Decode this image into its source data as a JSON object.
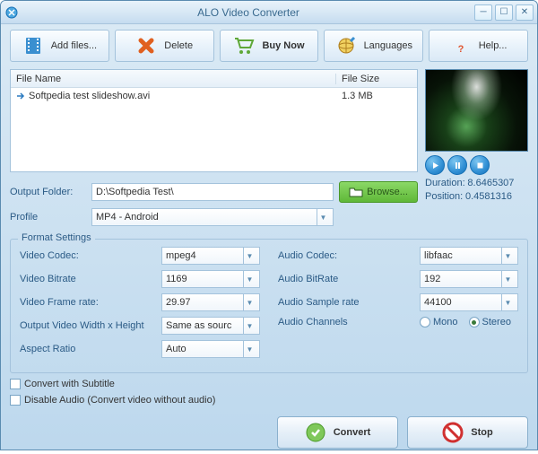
{
  "titlebar": {
    "title": "ALO Video Converter"
  },
  "toolbar": {
    "add_files": "Add files...",
    "delete": "Delete",
    "buy_now": "Buy Now",
    "languages": "Languages",
    "help": "Help..."
  },
  "file_list": {
    "header_name": "File Name",
    "header_size": "File Size",
    "rows": [
      {
        "name": "Softpedia test slideshow.avi",
        "size": "1.3 MB"
      }
    ]
  },
  "preview": {
    "duration_label": "Duration:",
    "duration_value": "8.6465307",
    "position_label": "Position:",
    "position_value": "0.4581316"
  },
  "output": {
    "folder_label": "Output Folder:",
    "folder_value": "D:\\Softpedia Test\\",
    "browse": "Browse...",
    "profile_label": "Profile",
    "profile_value": "MP4 - Android"
  },
  "format": {
    "legend": "Format Settings",
    "video_codec_label": "Video Codec:",
    "video_codec": "mpeg4",
    "video_bitrate_label": "Video Bitrate",
    "video_bitrate": "1169",
    "video_framerate_label": "Video Frame rate:",
    "video_framerate": "29.97",
    "output_wh_label": "Output Video Width x Height",
    "output_wh": "Same as sourc",
    "aspect_ratio_label": "Aspect Ratio",
    "aspect_ratio": "Auto",
    "audio_codec_label": "Audio Codec:",
    "audio_codec": "libfaac",
    "audio_bitrate_label": "Audio BitRate",
    "audio_bitrate": "192",
    "audio_sample_label": "Audio Sample rate",
    "audio_sample": "44100",
    "audio_channels_label": "Audio Channels",
    "mono_label": "Mono",
    "stereo_label": "Stereo"
  },
  "checks": {
    "convert_subtitle": "Convert with Subtitle",
    "disable_audio": "Disable Audio (Convert video without audio)"
  },
  "buttons": {
    "convert": "Convert",
    "stop": "Stop"
  }
}
